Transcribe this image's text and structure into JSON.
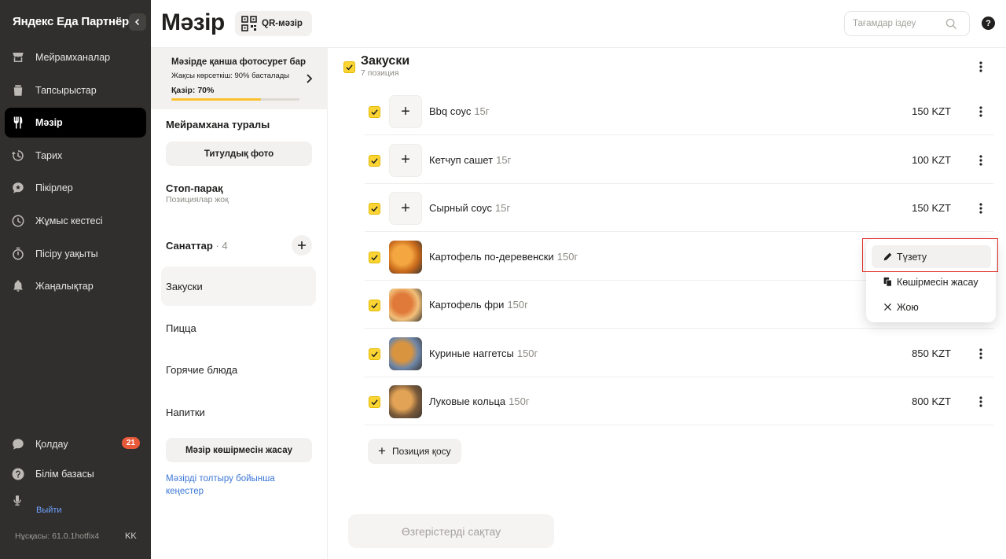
{
  "sidebar": {
    "brand": "Яндекс Еда Партнёры",
    "items": [
      {
        "label": "Мейрамханалар",
        "icon": "store-icon"
      },
      {
        "label": "Тапсырыстар",
        "icon": "orders-icon"
      },
      {
        "label": "Мәзір",
        "icon": "fork-knife-icon",
        "active": true
      },
      {
        "label": "Тарих",
        "icon": "history-icon"
      },
      {
        "label": "Пікірлер",
        "icon": "reviews-icon"
      },
      {
        "label": "Жұмыс кестесі",
        "icon": "clock-icon"
      },
      {
        "label": "Пісіру уақыты",
        "icon": "timer-icon"
      },
      {
        "label": "Жаңалықтар",
        "icon": "bell-icon"
      }
    ],
    "support": {
      "label": "Қолдау",
      "badge": "21"
    },
    "knowledge": {
      "label": "Білім базасы"
    },
    "logout": "Выйти",
    "version": "Нұсқасы: 61.0.1hotfix4",
    "lang": "KK"
  },
  "header": {
    "title": "Мәзір",
    "qr_label": "QR-мәзір",
    "search_placeholder": "Тағамдар іздеу",
    "help": "?"
  },
  "midcol": {
    "photo_card": {
      "title": "Мәзірде қанша фотосурет бар",
      "subtitle": "Жақсы көрсеткіш: 90% басталады",
      "current": "Қазір: 70%",
      "progress": 0.7
    },
    "about_title": "Мейрамхана туралы",
    "title_photo_btn": "Титулдық фото",
    "stop_title": "Стоп-парақ",
    "stop_sub": "Позициялар жоқ",
    "categories_title": "Санаттар",
    "categories_count": "· 4",
    "categories": [
      "Закуски",
      "Пицца",
      "Горячие блюда",
      "Напитки"
    ],
    "copy_menu_btn": "Мәзір көшірмесін жасау",
    "guide_link": "Мәзірді толтыру бойынша кеңестер"
  },
  "group": {
    "title": "Закуски",
    "subtitle": "7 позиция"
  },
  "items": [
    {
      "name": "Bbq соус",
      "weight": "15г",
      "price": "150 KZT",
      "photo": false
    },
    {
      "name": "Кетчуп сашет",
      "weight": "15г",
      "price": "100 KZT",
      "photo": false
    },
    {
      "name": "Сырный соус",
      "weight": "15г",
      "price": "150 KZT",
      "photo": false
    },
    {
      "name": "Картофель по-деревенски",
      "weight": "150г",
      "price": "",
      "photo": true
    },
    {
      "name": "Картофель фри",
      "weight": "150г",
      "price": "",
      "photo": true
    },
    {
      "name": "Куриные наггетсы",
      "weight": "150г",
      "price": "850 KZT",
      "photo": true
    },
    {
      "name": "Луковые кольца",
      "weight": "150г",
      "price": "800 KZT",
      "photo": true
    }
  ],
  "add_position": "Позиция қосу",
  "save_changes": "Өзгерістерді сақтау",
  "context_menu": {
    "edit": "Түзету",
    "copy": "Көшірмесін жасау",
    "delete": "Жою"
  },
  "colors": {
    "accent_yellow": "#fcd535",
    "sidebar_bg": "#302f2d",
    "highlight_red": "#e0322a",
    "badge": "#e8593a"
  }
}
